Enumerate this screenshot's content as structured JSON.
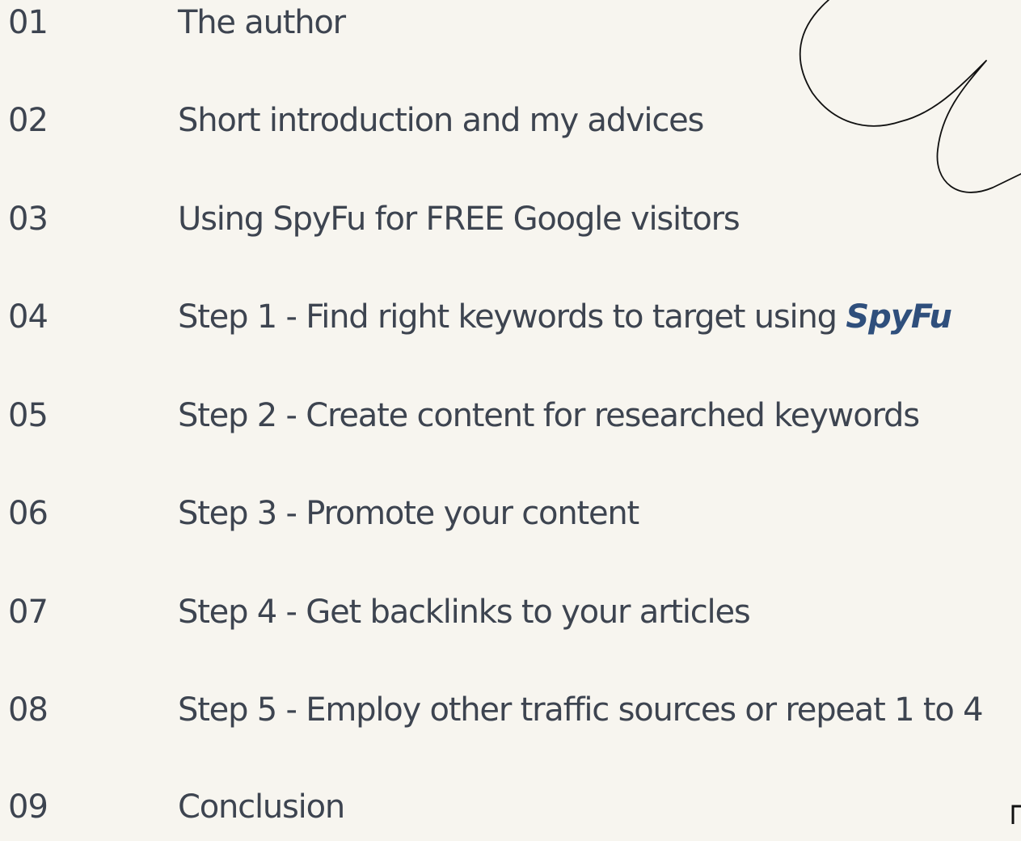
{
  "toc": {
    "items": [
      {
        "number": "01",
        "title": "The author"
      },
      {
        "number": "02",
        "title": "Short introduction and my advices"
      },
      {
        "number": "03",
        "title": "Using SpyFu for FREE Google visitors"
      },
      {
        "number": "04",
        "title": "Step 1 - Find right keywords to target using ",
        "brand": "SpyFu"
      },
      {
        "number": "05",
        "title": "Step 2 - Create content for researched keywords"
      },
      {
        "number": "06",
        "title": "Step 3 - Promote your content"
      },
      {
        "number": "07",
        "title": "Step 4 - Get backlinks to your articles"
      },
      {
        "number": "08",
        "title": "Step 5 - Employ other traffic sources or repeat 1 to 4"
      },
      {
        "number": "09",
        "title": "Conclusion"
      }
    ]
  },
  "colors": {
    "background": "#f7f5ef",
    "text": "#3d4450",
    "brand": "#2f4f7c",
    "line": "#111111"
  },
  "icons": {
    "decoration": "swirl-line-icon",
    "corner": "corner-bracket-icon"
  }
}
